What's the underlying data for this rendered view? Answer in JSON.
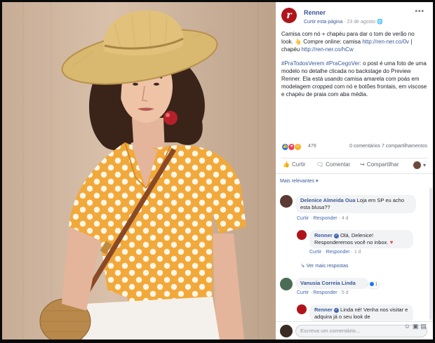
{
  "post": {
    "page_name": "Renner",
    "like_page": "Curtir esta página",
    "date": "23 de agosto",
    "separator": "·",
    "more": "•••",
    "paragraph1": "Camisa com nó + chapéu para dar o tom de verão no look. 👆 Compre online: camisa ",
    "link1": "http://ren-ner.co/0v",
    "paragraph1b": " | chapéu ",
    "link2": "http://ren-ner.co/hCw",
    "hashtags": "#PraTodosVerem #PraCegoVer:",
    "paragraph2": " o post é uma foto de uma modelo no detalhe clicada no backstage do Preview Renner. Ela está usando camisa amarela com poás em modelagem cropped com nó e botões frontais, em viscose e chapéu de praia com aba média."
  },
  "stats": {
    "reaction_count": "479",
    "comments": "0 comentários",
    "shares": "7 compartilhamentos"
  },
  "actions": {
    "like": "Curtir",
    "comment": "Comentar",
    "share": "Compartilhar"
  },
  "comments": {
    "most_relevant": "Mais relevantes",
    "c1": {
      "name": "Delenice Almeida Oua",
      "text": "Loja em SP eu acho esta blusa??",
      "like": "Curtir",
      "reply": "Responder",
      "time": "4 d"
    },
    "r1": {
      "name": "Renner",
      "text_a": "Olá, Delenice!",
      "text_b": "Responderemos você no inbox.",
      "like": "Curtir",
      "reply": "Responder",
      "time": "1 d"
    },
    "more_replies": "Ver mais respostas",
    "c2": {
      "name": "Vanusia Correia Linda",
      "like": "Curtir",
      "reply": "Responder",
      "time": "5 d",
      "likes": "1"
    },
    "r2": {
      "name": "Renner",
      "text": "Linda né! Venha nos visitar e adquira já o seu look de"
    },
    "write_placeholder": "Escreva um comentário..."
  },
  "colors": {
    "brand_red": "#b0141b",
    "fb_blue": "#365899",
    "shirt_yellow": "#f2a93b"
  }
}
